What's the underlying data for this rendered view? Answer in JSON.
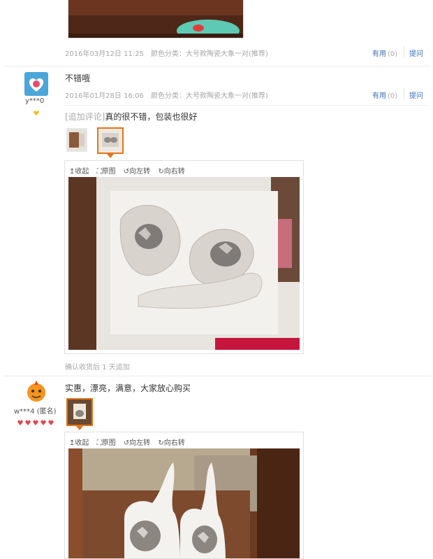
{
  "review1": {
    "date": "2016年03月12日 11:25",
    "spec": "颜色分类：大号款陶瓷大象一对(推荐)",
    "useful_label": "有用",
    "useful_count": "(0)",
    "reply_label": "提问"
  },
  "review2": {
    "username": "y***0",
    "comment": "不错哦",
    "date": "2016年01月28日 16:06",
    "spec": "颜色分类：大号款陶瓷大象一对(推荐)",
    "useful_label": "有用",
    "useful_count": "(0)",
    "reply_label": "提问",
    "append_tag": "[追加评论]",
    "append_text": "真的很不错，包装也很好",
    "append_time": "确认收货后 1 天追加",
    "viewer": {
      "collapse": "收起",
      "original": "原图",
      "rotate_left": "向左转",
      "rotate_right": "向右转"
    }
  },
  "review3": {
    "username": "w***4 (匿名)",
    "comment": "实惠，漂亮，满意，大家放心购买",
    "viewer": {
      "collapse": "收起",
      "original": "原图",
      "rotate_left": "向左转",
      "rotate_right": "向右转"
    }
  },
  "colors": {
    "accent": "#e4761c",
    "link": "#3c6fb5",
    "meta": "#a7a7a7"
  },
  "icons": [
    "collapse-arrow-icon",
    "expand-icon",
    "rotate-left-icon",
    "rotate-right-icon",
    "heart-badge-icon"
  ]
}
